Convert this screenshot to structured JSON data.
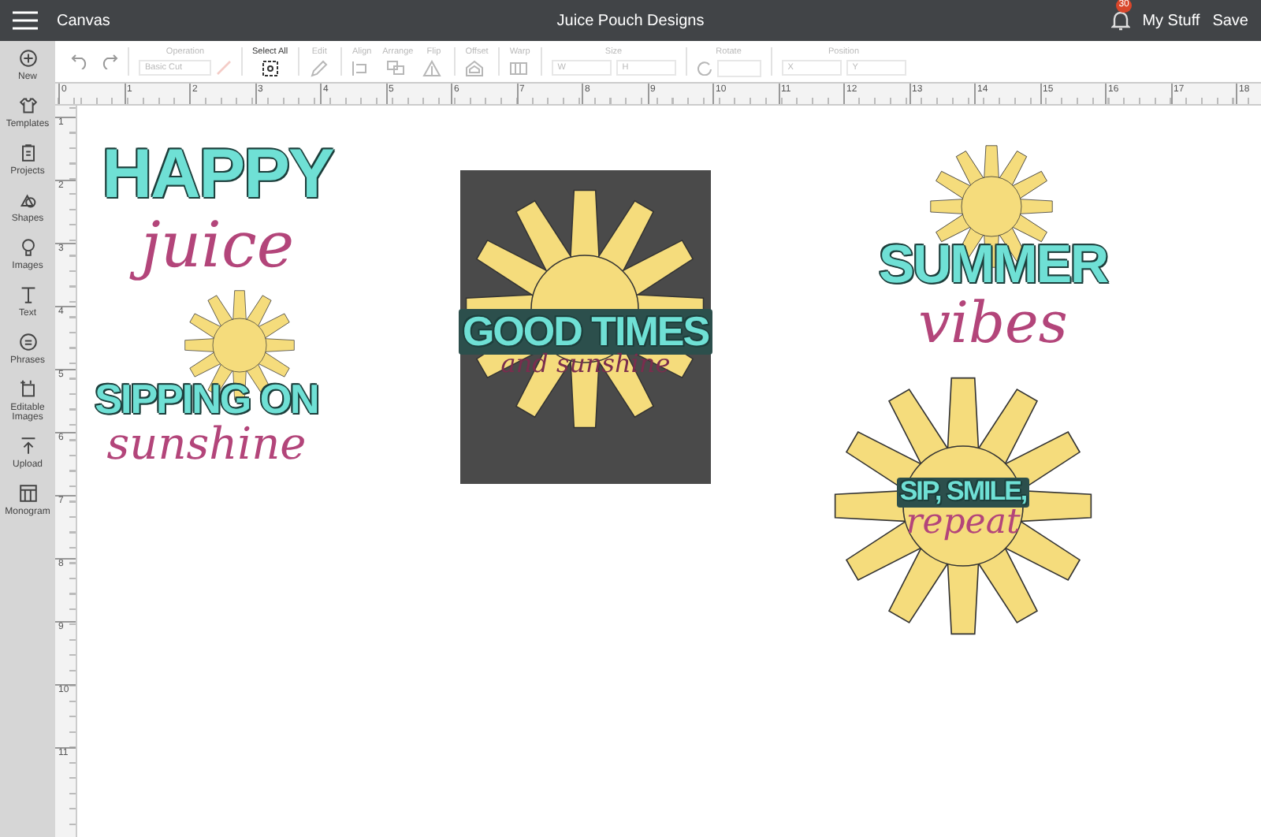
{
  "top_bar": {
    "menu_label": "Canvas",
    "title": "Juice Pouch Designs",
    "notification_count": "30",
    "my_stuff": "My Stuff",
    "save": "Save"
  },
  "sidebar": {
    "items": [
      {
        "label": "New"
      },
      {
        "label": "Templates"
      },
      {
        "label": "Projects"
      },
      {
        "label": "Shapes"
      },
      {
        "label": "Images"
      },
      {
        "label": "Text"
      },
      {
        "label": "Phrases"
      },
      {
        "label": "Editable Images"
      },
      {
        "label": "Upload"
      },
      {
        "label": "Monogram"
      }
    ]
  },
  "toolbar": {
    "operation": {
      "label": "Operation",
      "value": "Basic Cut",
      "disabled": true
    },
    "tools": [
      {
        "kind": "select",
        "label": "Select All",
        "disabled": false
      },
      {
        "kind": "edit",
        "label": "Edit",
        "disabled": true
      },
      {
        "kind": "align",
        "label": "Align",
        "disabled": true
      },
      {
        "kind": "arrange",
        "label": "Arrange",
        "disabled": true
      },
      {
        "kind": "flip",
        "label": "Flip",
        "disabled": true
      },
      {
        "kind": "offset",
        "label": "Offset",
        "disabled": true
      },
      {
        "kind": "warp",
        "label": "Warp",
        "disabled": true
      }
    ],
    "size": {
      "label": "Size",
      "w": "W",
      "h": "H",
      "disabled": true
    },
    "rotate": {
      "label": "Rotate",
      "disabled": true
    },
    "position": {
      "label": "Position",
      "x": "X",
      "y": "Y",
      "disabled": true
    }
  },
  "rulers": {
    "horizontal": [
      "0",
      "1",
      "2",
      "3",
      "4",
      "5",
      "6",
      "7",
      "8",
      "9",
      "10",
      "11",
      "12",
      "13",
      "14",
      "15",
      "16",
      "17",
      "18"
    ],
    "vertical": [
      "1",
      "2",
      "3",
      "4",
      "5",
      "6",
      "7",
      "8",
      "9",
      "10",
      "11"
    ]
  },
  "designs": [
    {
      "background": false,
      "sun": false,
      "lines": [
        {
          "kind": "block",
          "text": "HAPPY"
        },
        {
          "kind": "script",
          "text": "juice"
        }
      ]
    },
    {
      "background": false,
      "sun": true,
      "lines": [
        {
          "kind": "block",
          "text": "SIPPING ON"
        },
        {
          "kind": "script",
          "text": "sunshine"
        }
      ]
    },
    {
      "background": true,
      "sun": true,
      "lines": [
        {
          "kind": "block",
          "text": "GOOD TIMES"
        },
        {
          "kind": "script",
          "text": "and sunshine"
        }
      ]
    },
    {
      "background": false,
      "sun": true,
      "lines": [
        {
          "kind": "block",
          "text": "SUMMER"
        },
        {
          "kind": "script",
          "text": "vibes"
        }
      ]
    },
    {
      "background": false,
      "sun": true,
      "lines": [
        {
          "kind": "block",
          "text": "SIP, SMILE,"
        },
        {
          "kind": "script",
          "text": "repeat"
        }
      ]
    }
  ]
}
